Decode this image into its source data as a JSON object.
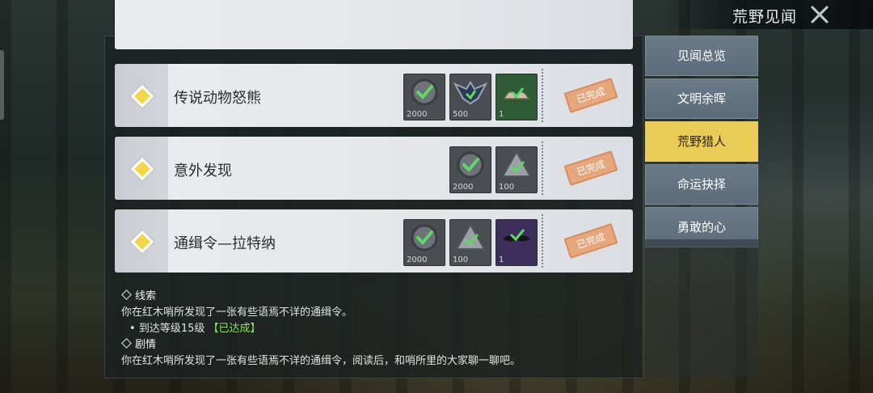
{
  "header": {
    "title": "荒野见闻"
  },
  "tabs": [
    {
      "label": "见闻总览",
      "active": false
    },
    {
      "label": "文明余晖",
      "active": false
    },
    {
      "label": "荒野猎人",
      "active": true
    },
    {
      "label": "命运抉择",
      "active": false
    },
    {
      "label": "勇敢的心",
      "active": false
    }
  ],
  "quests": [
    {
      "name": "传说动物怒熊",
      "status": "已完成",
      "rewards": [
        {
          "icon": "check-coin-icon",
          "amount": "2000"
        },
        {
          "icon": "bird-emblem-icon",
          "amount": "500"
        },
        {
          "icon": "green-item-icon",
          "amount": "1"
        }
      ]
    },
    {
      "name": "意外发现",
      "status": "已完成",
      "rewards": [
        {
          "icon": "check-coin-icon",
          "amount": "2000"
        },
        {
          "icon": "triangle-xp-icon",
          "amount": "100"
        }
      ]
    },
    {
      "name": "通缉令—拉特纳",
      "status": "已完成",
      "rewards": [
        {
          "icon": "check-coin-icon",
          "amount": "2000"
        },
        {
          "icon": "triangle-xp-icon",
          "amount": "100"
        },
        {
          "icon": "mustache-icon",
          "amount": "1"
        }
      ]
    }
  ],
  "details": {
    "clue_title": "线索",
    "clue_text": "你在红木哨所发现了一张有些语焉不详的通缉令。",
    "clue_req": "到达等级15级",
    "clue_req_status": "【已达成】",
    "story_title": "剧情",
    "story_text": "你在红木哨所发现了一张有些语焉不详的通缉令，阅读后，和哨所里的大家聊一聊吧。"
  },
  "colors": {
    "accent": "#e9cb55",
    "tab": "#63727f",
    "stamp": "#e7a77d",
    "ok": "#8fdc6a"
  }
}
